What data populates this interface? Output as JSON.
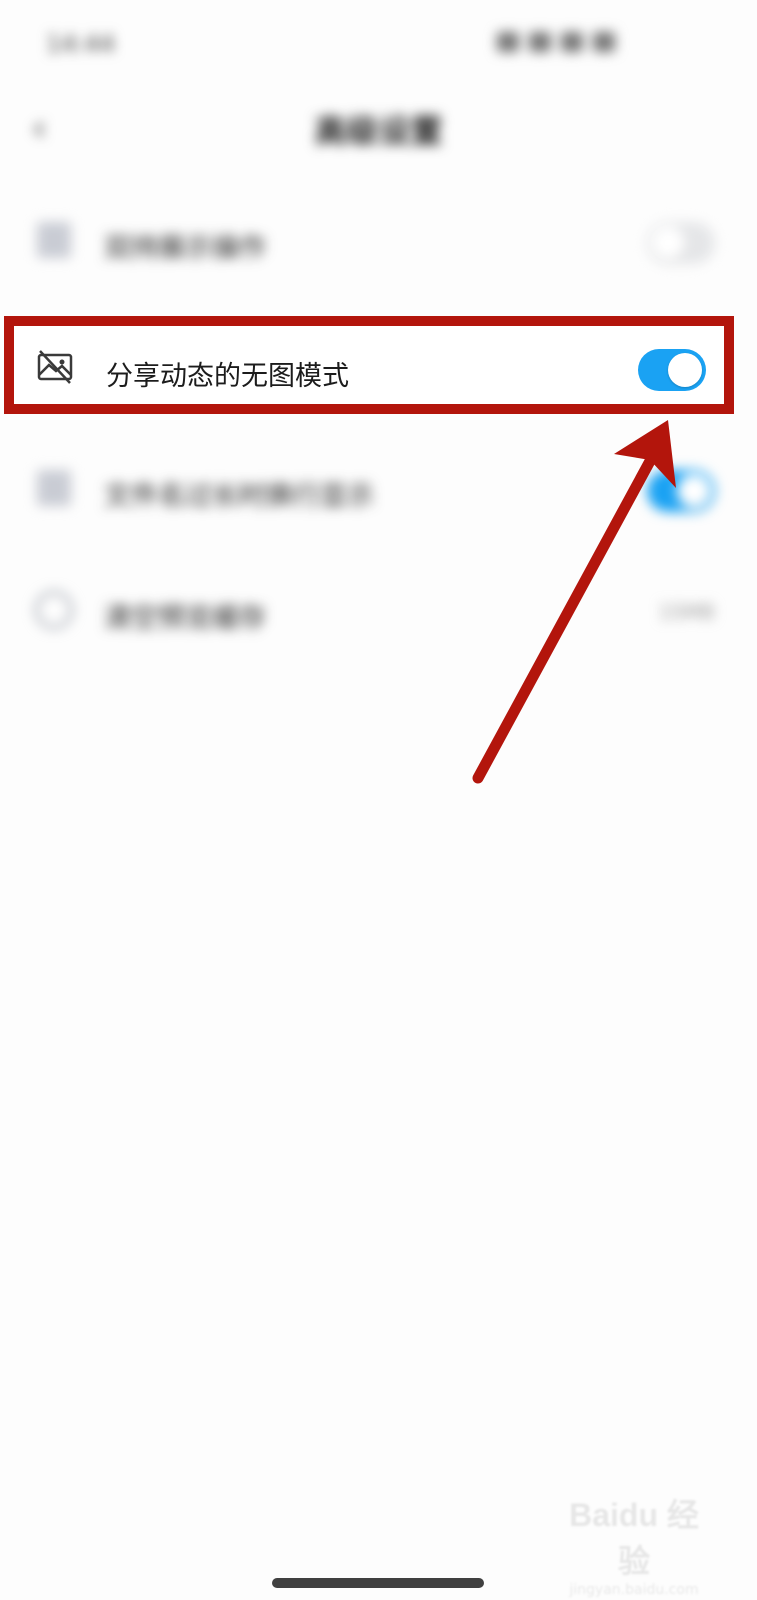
{
  "status_bar": {
    "time": "14:44"
  },
  "header": {
    "back_symbol": "‹",
    "title": "高级设置"
  },
  "settings": [
    {
      "label": "双持展示操作",
      "control": "toggle",
      "state": "off",
      "icon": "document-icon"
    },
    {
      "label": "分享动态的无图模式",
      "control": "toggle",
      "state": "on",
      "icon": "no-image-icon",
      "highlighted": true
    },
    {
      "label": "文件名过长时换行显示",
      "control": "toggle",
      "state": "on",
      "icon": "file-icon"
    },
    {
      "label": "清空预览缓存",
      "control": "value",
      "value": "15MB",
      "icon": "clock-icon"
    }
  ],
  "colors": {
    "toggle_on": "#1aa2f3",
    "toggle_off": "#e5e6e8",
    "annotation": "#b3150c"
  },
  "watermark": {
    "brand": "Baidu 经验",
    "sub": "jingyan.baidu.com"
  }
}
